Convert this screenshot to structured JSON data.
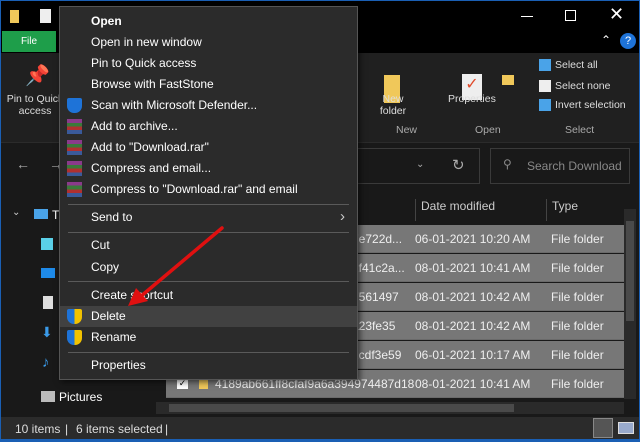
{
  "window": {
    "tab_file": "File"
  },
  "ribbon": {
    "pin_label": "Pin to Quick access",
    "new_folder": "New folder",
    "properties": "Properties",
    "select_all": "Select all",
    "select_none": "Select none",
    "invert_selection": "Invert selection",
    "groups": {
      "new": "New",
      "open": "Open",
      "select": "Select"
    }
  },
  "search": {
    "placeholder": "Search Download"
  },
  "list": {
    "columns": [
      "Date modified",
      "Type"
    ],
    "rows": [
      {
        "name": "7e722d...",
        "date": "06-01-2021 10:20 AM",
        "type": "File folder"
      },
      {
        "name": "1f41c2a...",
        "date": "08-01-2021 10:41 AM",
        "type": "File folder"
      },
      {
        "name": "7561497",
        "date": "08-01-2021 10:42 AM",
        "type": "File folder"
      },
      {
        "name": "a23fe35",
        "date": "08-01-2021 10:42 AM",
        "type": "File folder"
      },
      {
        "name": "2cdf3e59",
        "date": "06-01-2021 10:17 AM",
        "type": "File folder"
      },
      {
        "name": "4189ab661ff8cfaf9a6a394974487d18",
        "date": "08-01-2021 10:41 AM",
        "type": "File folder"
      }
    ]
  },
  "nav": {
    "this_pc": "Th",
    "pictures": "Pictures"
  },
  "status": {
    "items": "10 items",
    "selected": "6 items selected"
  },
  "menu": {
    "open": "Open",
    "open_new_window": "Open in new window",
    "pin": "Pin to Quick access",
    "faststone": "Browse with FastStone",
    "defender": "Scan with Microsoft Defender...",
    "add_archive": "Add to archive...",
    "add_rar": "Add to \"Download.rar\"",
    "compress_email": "Compress and email...",
    "compress_rar_email": "Compress to \"Download.rar\" and email",
    "send_to": "Send to",
    "cut": "Cut",
    "copy": "Copy",
    "create_shortcut": "Create shortcut",
    "delete": "Delete",
    "rename": "Rename",
    "properties": "Properties"
  },
  "colors": {
    "file_tab": "#1e9e4a",
    "arrow": "#e01010",
    "selection": "#777777"
  }
}
